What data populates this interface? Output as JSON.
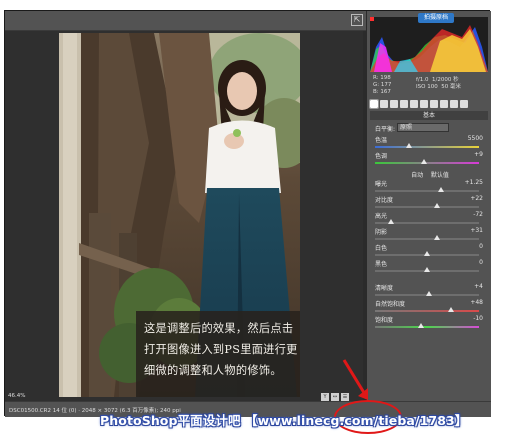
{
  "caption": {
    "line1": "这是调整后的效果，然后点击",
    "line2": "打开图像进入到PS里面进行更",
    "line3": "细微的调整和人物的修饰。"
  },
  "histogram": {
    "title": "拍摄原档",
    "colors": {
      "red": "#ff2a2a",
      "green": "#38e038",
      "blue": "#2a5aff",
      "yellow": "#ffe23a",
      "cyan": "#2ad8ff",
      "magenta": "#ff2aff"
    }
  },
  "readout": {
    "r": "R: 198",
    "g": "G: 177",
    "b": "B: 167",
    "aperture": "f/1.0",
    "shutter": "1/2000 秒",
    "iso": "ISO 100",
    "focal": "50 毫米"
  },
  "panel": {
    "basic_title": "基本",
    "wb_label": "白平衡:",
    "wb_value": "原照",
    "temp_label": "色温",
    "temp_value": "5500",
    "tint_label": "色调",
    "tint_value": "+9",
    "auto_label": "自动",
    "default_label": "默认值",
    "exposure_label": "曝光",
    "exposure_value": "+1.25",
    "contrast_label": "对比度",
    "contrast_value": "+22",
    "highlights_label": "高光",
    "highlights_value": "-72",
    "shadows_label": "阴影",
    "shadows_value": "+31",
    "whites_label": "白色",
    "whites_value": "0",
    "blacks_label": "黑色",
    "blacks_value": "0",
    "clarity_label": "清晰度",
    "clarity_value": "+4",
    "vibrance_label": "自然饱和度",
    "vibrance_value": "+48",
    "saturation_label": "饱和度",
    "saturation_value": "-10",
    "slider_levels": {
      "temp": 0.33,
      "tint": 0.47,
      "exposure": 0.63,
      "contrast": 0.6,
      "highlights": 0.15,
      "shadows": 0.6,
      "whites": 0.5,
      "blacks": 0.5,
      "clarity": 0.52,
      "vibrance": 0.73,
      "saturation": 0.44
    }
  },
  "bottom": {
    "zoom": "46.4%",
    "file_info": "DSC01500.CR2  14 位 (0)  · 2048 × 3072 (6.3 百万像素); 240 ppi"
  },
  "watermark": "PhotoShop平面设计吧 【www.linecg.com/tieba/1783】"
}
